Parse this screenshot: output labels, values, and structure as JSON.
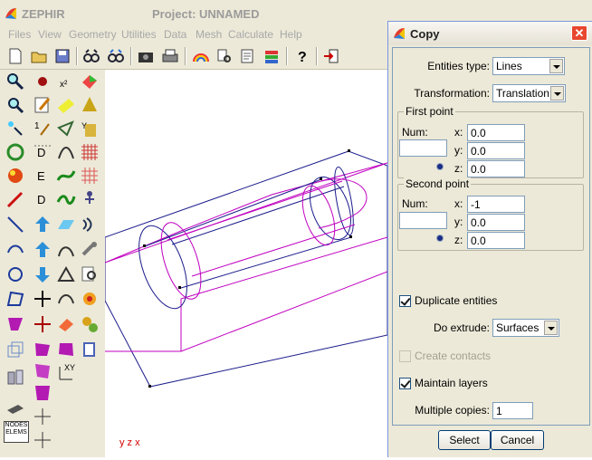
{
  "app": {
    "name": "ZEPHIR",
    "project_title": "Project: UNNAMED"
  },
  "menu": [
    "Files",
    "View",
    "Geometry",
    "Utilities",
    "Data",
    "Mesh",
    "Calculate",
    "Help"
  ],
  "toolbar": [
    "new-file-icon",
    "open-folder-icon",
    "save-disk-icon",
    "zoom-glasses-icon",
    "zoom-glasses-alt-icon",
    "camera-icon",
    "print-icon",
    "rainbow-icon",
    "lookup-icon",
    "notes-icon",
    "layers-books-icon",
    "help-question-icon",
    "exit-door-icon"
  ],
  "canvas": {
    "axis_label": "y z x"
  },
  "dialog": {
    "title": "Copy",
    "entities_type": {
      "label": "Entities type:",
      "value": "Lines"
    },
    "transformation": {
      "label": "Transformation:",
      "value": "Translation"
    },
    "first_point": {
      "title": "First point",
      "num_label": "Num:",
      "num_value": "",
      "x_label": "x:",
      "x": "0.0",
      "y_label": "y:",
      "y": "0.0",
      "z_label": "z:",
      "z": "0.0"
    },
    "second_point": {
      "title": "Second point",
      "num_label": "Num:",
      "num_value": "",
      "x_label": "x:",
      "x": "-1",
      "y_label": "y:",
      "y": "0.0",
      "z_label": "z:",
      "z": "0.0"
    },
    "duplicate_entities": {
      "label": "Duplicate entities",
      "checked": true
    },
    "do_extrude": {
      "label": "Do extrude:",
      "value": "Surfaces"
    },
    "create_contacts": {
      "label": "Create contacts",
      "checked": false,
      "disabled": true
    },
    "maintain_layers": {
      "label": "Maintain layers",
      "checked": true
    },
    "multiple_copies": {
      "label": "Multiple copies:",
      "value": "1"
    },
    "select_button": "Select",
    "cancel_button": "Cancel"
  },
  "colors": {
    "model_blue": "#1c1c8c",
    "model_magenta": "#c000c0",
    "window_bg": "#ece9d8"
  }
}
